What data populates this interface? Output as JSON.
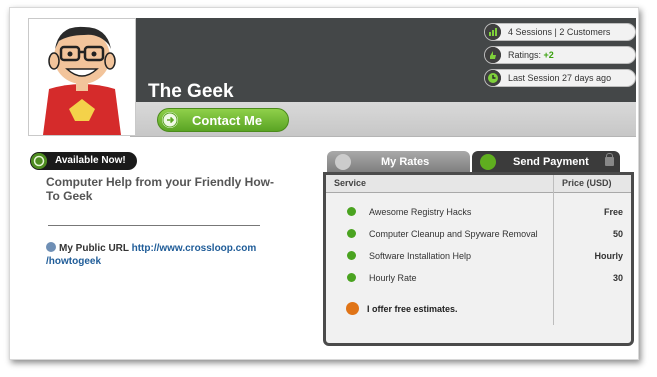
{
  "profile": {
    "name": "The Geek",
    "contact_label": "Contact Me"
  },
  "stats": {
    "sessions": "4 Sessions | 2 Customers",
    "ratings_label": "Ratings:",
    "ratings_value": "+2",
    "last_session": "Last Session 27 days ago"
  },
  "availability": "Available Now!",
  "headline": "Computer Help from your Friendly How-To Geek",
  "public_url": {
    "label": "My Public URL",
    "link": "http://www.crossloop.com /howtogeek"
  },
  "tabs": {
    "rates": "My Rates",
    "payment": "Send Payment"
  },
  "rates_table": {
    "headers": {
      "service": "Service",
      "price": "Price (USD)"
    },
    "rows": [
      {
        "service": "Awesome Registry Hacks",
        "price": "Free"
      },
      {
        "service": "Computer Cleanup and Spyware Removal",
        "price": "50"
      },
      {
        "service": "Software Installation Help",
        "price": "Hourly"
      },
      {
        "service": "Hourly Rate",
        "price": "30"
      }
    ],
    "note": "I offer free estimates."
  },
  "icons": {
    "sessions": "bar-chart-icon",
    "ratings": "thumbs-icon",
    "last_session": "clock-icon",
    "availability": "power-icon",
    "contact": "arrow-right-icon",
    "row_bullet": "green-arrow-icon",
    "note": "exclamation-icon",
    "url": "globe-icon"
  },
  "colors": {
    "header_dark": "#444748",
    "accent_green": "#5aa424",
    "link_blue": "#1f5c98",
    "note_orange": "#e07417"
  }
}
